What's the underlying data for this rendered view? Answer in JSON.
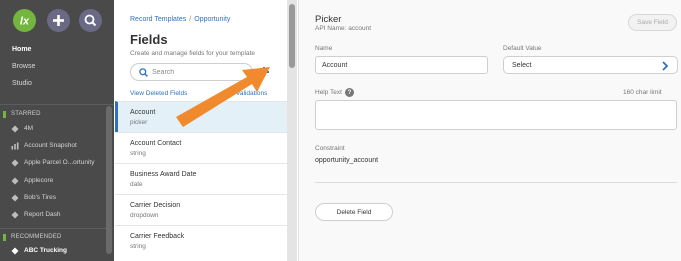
{
  "nav": {
    "items": [
      {
        "label": "Home",
        "active": true
      },
      {
        "label": "Browse",
        "active": false
      },
      {
        "label": "Studio",
        "active": false
      }
    ],
    "starred_header": "STARRED",
    "starred": [
      {
        "label": "4M",
        "icon": "diamond-icon"
      },
      {
        "label": "Account Snapshot",
        "icon": "bar-chart-icon"
      },
      {
        "label": "Apple Parcel O...ortunity",
        "icon": "diamond-icon"
      },
      {
        "label": "Applecore",
        "icon": "diamond-icon"
      },
      {
        "label": "Bob's Tires",
        "icon": "diamond-icon"
      },
      {
        "label": "Report Dash",
        "icon": "diamond-icon"
      }
    ],
    "recommended_header": "RECOMMENDED",
    "recommended": [
      {
        "label": "ABC Trucking",
        "icon": "diamond-icon"
      }
    ],
    "colors": {
      "sidebar_bg": "#4a4a4a",
      "accent_green": "#73b63f"
    }
  },
  "fields_panel": {
    "breadcrumb": {
      "part1": "Record Templates",
      "separator": "/",
      "part2": "Opportunity"
    },
    "title": "Fields",
    "subtitle": "Create and manage fields for your template",
    "search_placeholder": "Search",
    "view_deleted_label": "View Deleted Fields",
    "validations_label": "Validations",
    "fields": [
      {
        "name": "Account",
        "type": "picker",
        "selected": true
      },
      {
        "name": "Account Contact",
        "type": "string",
        "selected": false
      },
      {
        "name": "Business Award Date",
        "type": "date",
        "selected": false
      },
      {
        "name": "Carrier Decision",
        "type": "dropdown",
        "selected": false
      },
      {
        "name": "Carrier Feedback",
        "type": "string",
        "selected": false
      }
    ]
  },
  "detail": {
    "title": "Picker",
    "api_name": "API Name: account",
    "save_label": "Save Field",
    "name_label": "Name",
    "name_value": "Account",
    "default_label": "Default Value",
    "default_value": "Select",
    "help_text_label": "Help Text",
    "char_limit": "160 char limit",
    "constraint_label": "Constraint",
    "constraint_value": "opportunity_account",
    "delete_label": "Delete Field"
  },
  "annotation": {
    "arrow_color": "#f08a2c"
  }
}
